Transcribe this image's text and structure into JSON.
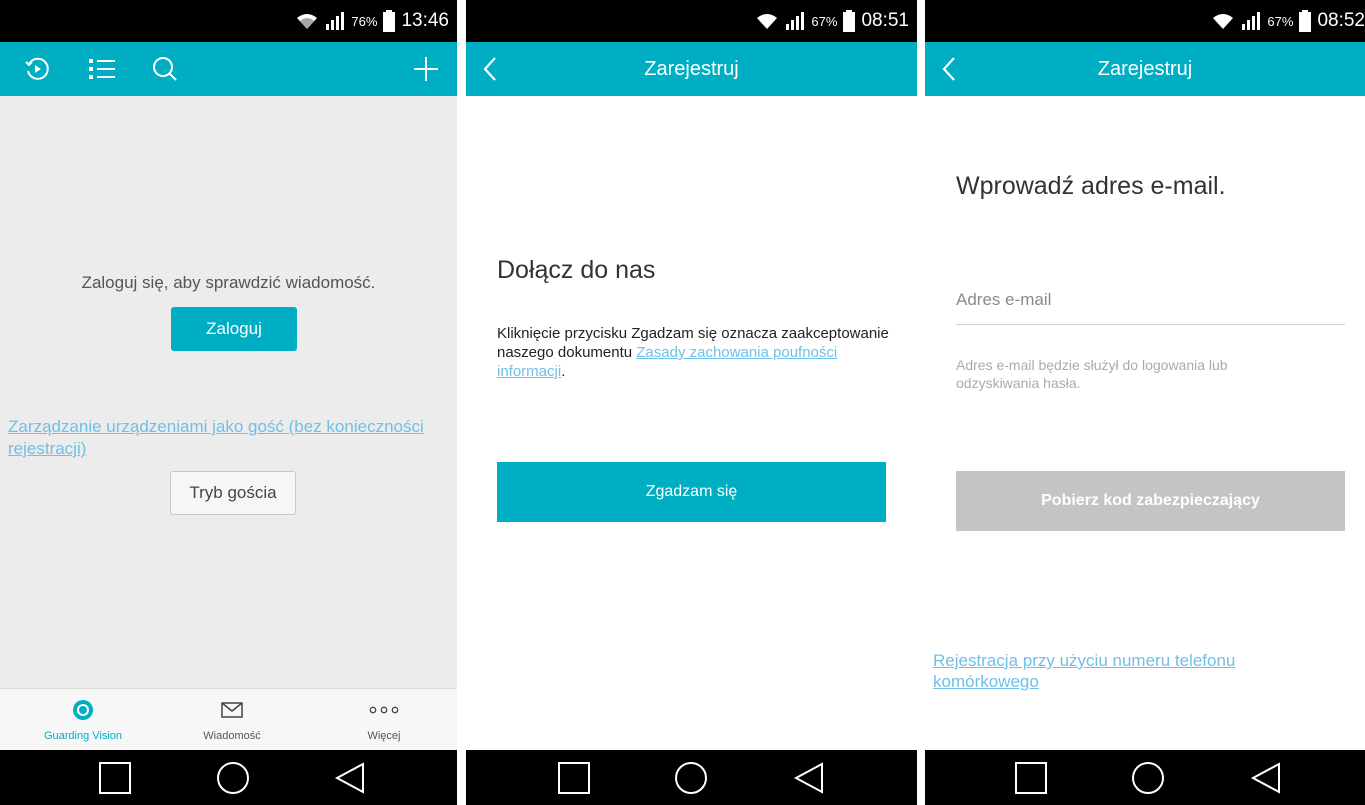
{
  "screens": [
    {
      "status": {
        "battery": "76%",
        "time": "13:46"
      },
      "toolbar": {
        "icons": [
          "history-icon",
          "list-icon",
          "search-icon",
          "add-icon"
        ]
      },
      "message": "Zaloguj się, aby sprawdzić wiadomość.",
      "login_button": "Zaloguj",
      "guest_link": "Zarządzanie urządzeniami jako gość (bez konieczności rejestracji)",
      "guest_button": "Tryb gościa",
      "tabs": [
        {
          "label": "Guarding Vision",
          "icon": "guarding-vision-icon",
          "active": true
        },
        {
          "label": "Wiadomość",
          "icon": "envelope-icon",
          "active": false
        },
        {
          "label": "Więcej",
          "icon": "more-dots-icon",
          "active": false
        }
      ]
    },
    {
      "status": {
        "battery": "67%",
        "time": "08:51"
      },
      "title": "Zarejestruj",
      "heading": "Dołącz do nas",
      "terms_text": "Kliknięcie przycisku Zgadzam się oznacza zaakceptowanie naszego dokumentu ",
      "terms_link": "Zasady zachowania poufności informacji",
      "terms_end": ".",
      "agree_button": "Zgadzam się"
    },
    {
      "status": {
        "battery": "67%",
        "time": "08:52"
      },
      "title": "Zarejestruj",
      "heading": "Wprowadź adres e-mail.",
      "email": {
        "placeholder": "Adres e-mail",
        "value": ""
      },
      "hint": "Adres e-mail będzie służył do logowania lub odzyskiwania hasła.",
      "code_button": "Pobierz kod zabezpieczający",
      "phone_link": "Rejestracja przy użyciu numeru telefonu komórkowego"
    }
  ],
  "colors": {
    "accent": "#00aec4",
    "link": "#6fc0e8",
    "disabled": "#c4c4c4"
  }
}
